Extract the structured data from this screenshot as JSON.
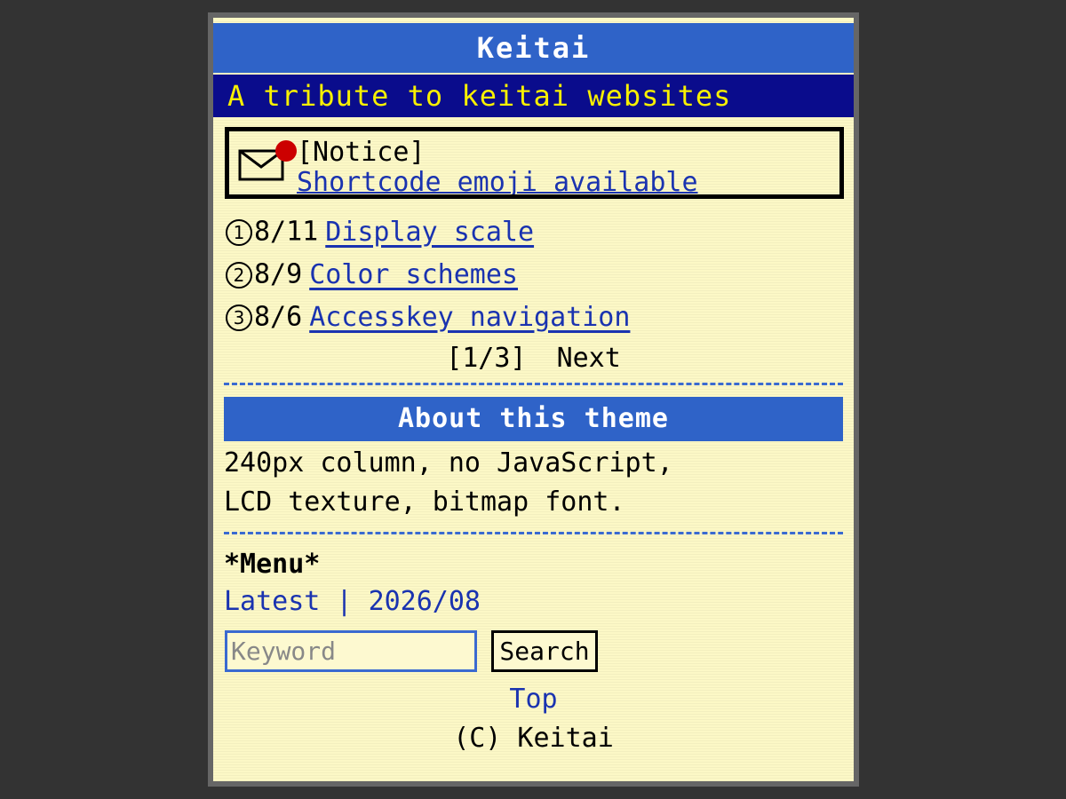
{
  "header": {
    "title": "Keitai",
    "tagline": "A tribute to keitai websites"
  },
  "notice": {
    "label": "[Notice]",
    "link_text": "Shortcode emoji available",
    "icon": "mail-with-red-dot-icon"
  },
  "news": [
    {
      "num": "1",
      "date": "8/11",
      "title": "Display scale"
    },
    {
      "num": "2",
      "date": "8/9",
      "title": "Color schemes"
    },
    {
      "num": "3",
      "date": "8/6",
      "title": "Accesskey navigation"
    }
  ],
  "pager": {
    "current": "[1/3]",
    "next": "Next"
  },
  "about": {
    "heading": "About this theme",
    "line1": "240px column, no JavaScript,",
    "line2": "LCD texture, bitmap font."
  },
  "menu": {
    "title": "*Menu*",
    "latest": "Latest",
    "separator": "|",
    "archive": "2026/08"
  },
  "search": {
    "placeholder": "Keyword",
    "button_label": "Search"
  },
  "footer": {
    "top_link": "Top",
    "copyright": "(C) Keitai"
  },
  "colors": {
    "background": "#333333",
    "screen": "#fcf8c6",
    "title_bar": "#2f63c8",
    "tagline_bar": "#0a0c8c",
    "tagline_text": "#f8f000",
    "link": "#1a33b0",
    "notice_dot": "#cc0000"
  }
}
